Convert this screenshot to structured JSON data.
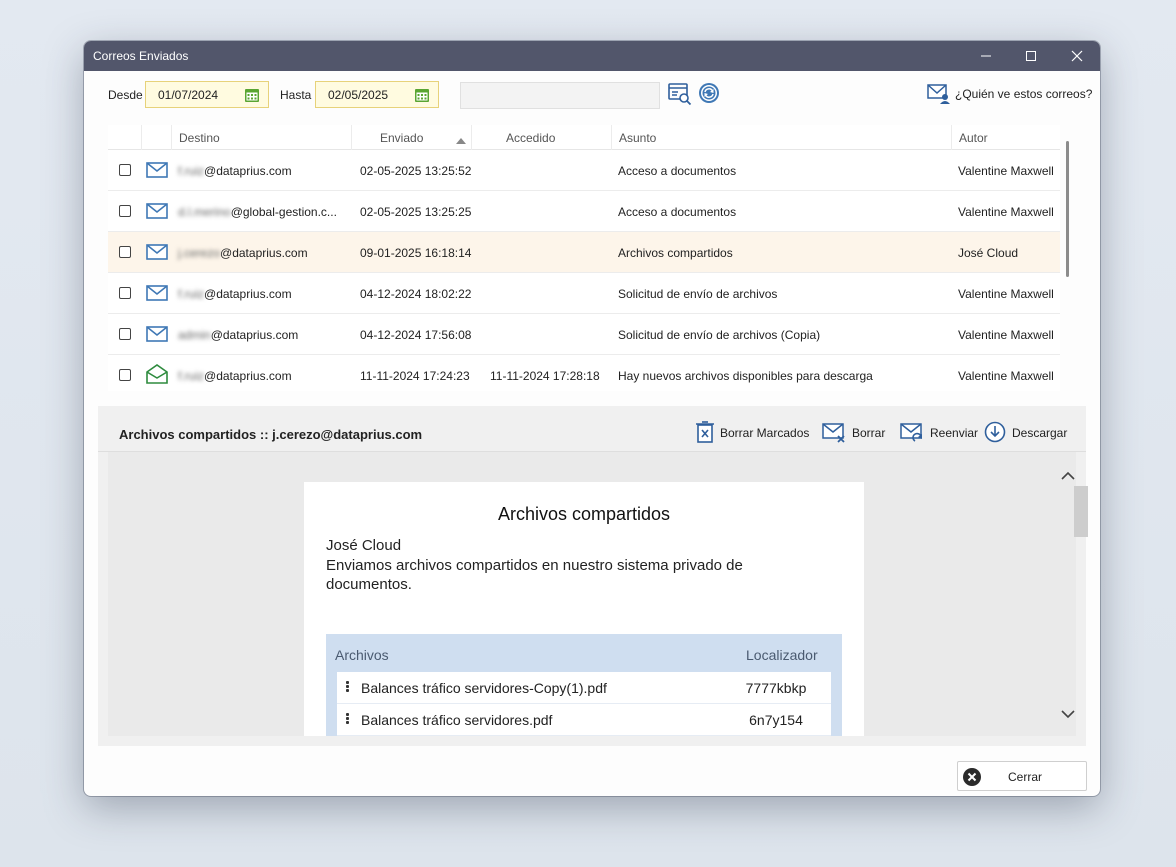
{
  "window": {
    "title": "Correos Enviados"
  },
  "filters": {
    "from_label": "Desde",
    "from_value": "01/07/2024",
    "to_label": "Hasta",
    "to_value": "02/05/2025",
    "search_value": ""
  },
  "who_sees": "¿Quién ve estos correos?",
  "grid": {
    "columns": [
      "Destino",
      "Enviado",
      "Accedido",
      "Asunto",
      "Autor"
    ],
    "rows": [
      {
        "dest_hidden": "f.ruiz",
        "dest_domain": "@dataprius.com",
        "sent": "02-05-2025 13:25:52",
        "accessed": "",
        "subject": "Acceso a documentos",
        "author": "Valentine Maxwell",
        "icon": "mail-closed-icon"
      },
      {
        "dest_hidden": "d.l.merino",
        "dest_domain": "@global-gestion.c...",
        "sent": "02-05-2025 13:25:25",
        "accessed": "",
        "subject": "Acceso a documentos",
        "author": "Valentine Maxwell",
        "icon": "mail-closed-icon"
      },
      {
        "dest_hidden": "j.cerezo",
        "dest_domain": "@dataprius.com",
        "sent": "09-01-2025 16:18:14",
        "accessed": "",
        "subject": "Archivos compartidos",
        "author": "José Cloud",
        "icon": "mail-closed-icon"
      },
      {
        "dest_hidden": "f.ruiz",
        "dest_domain": "@dataprius.com",
        "sent": "04-12-2024 18:02:22",
        "accessed": "",
        "subject": "Solicitud de envío de archivos",
        "author": "Valentine Maxwell",
        "icon": "mail-closed-icon"
      },
      {
        "dest_hidden": "admin",
        "dest_domain": "@dataprius.com",
        "sent": "04-12-2024 17:56:08",
        "accessed": "",
        "subject": "Solicitud de envío de archivos (Copia)",
        "author": "Valentine Maxwell",
        "icon": "mail-closed-icon"
      },
      {
        "dest_hidden": "f.ruiz",
        "dest_domain": "@dataprius.com",
        "sent": "11-11-2024 17:24:23",
        "accessed": "11-11-2024 17:28:18",
        "subject": "Hay nuevos archivos disponibles para descarga",
        "author": "Valentine Maxwell",
        "icon": "mail-open-icon"
      }
    ]
  },
  "preview": {
    "header": "Archivos compartidos :: j.cerezo@dataprius.com",
    "actions": {
      "delete_marked": "Borrar Marcados",
      "delete": "Borrar",
      "resend": "Reenviar",
      "download": "Descargar"
    },
    "email": {
      "title": "Archivos compartidos",
      "sender": "José Cloud",
      "message": "Enviamos archivos compartidos en nuestro sistema privado de documentos.",
      "table_headers": {
        "files": "Archivos",
        "locator": "Localizador"
      },
      "files": [
        {
          "name": "Balances tráfico servidores-Copy(1).pdf",
          "locator": "7777kbkp"
        },
        {
          "name": "Balances tráfico servidores.pdf",
          "locator": "6n7y154"
        }
      ]
    }
  },
  "close_button": "Cerrar",
  "colors": {
    "titlebar": "#52566b",
    "mail_icon": "#3f78b5",
    "opened_icon": "#2e8b3e",
    "selected_row": "#fdf5ea",
    "date_field": "#fffbe0"
  }
}
